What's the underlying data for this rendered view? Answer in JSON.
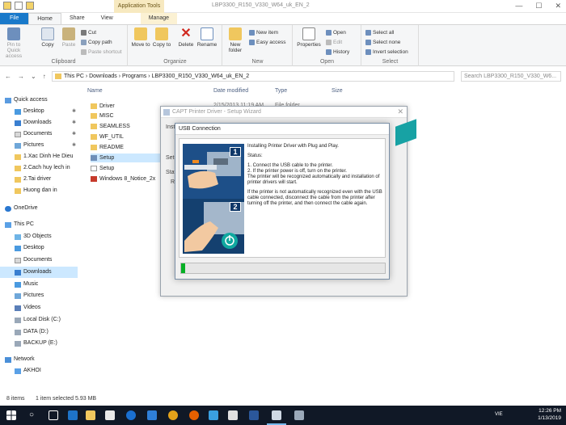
{
  "window": {
    "title": "LBP3300_R150_V330_W64_uk_EN_2",
    "context_tab_group": "Application Tools",
    "controls": [
      "—",
      "☐",
      "✕"
    ]
  },
  "ribbon_tabs": [
    "File",
    "Home",
    "Share",
    "View",
    "Manage"
  ],
  "ribbon": {
    "clipboard": {
      "label": "Clipboard",
      "pin": "Pin to Quick access",
      "copy": "Copy",
      "paste": "Paste",
      "cut": "Cut",
      "copy_path": "Copy path",
      "paste_shortcut": "Paste shortcut"
    },
    "organize": {
      "label": "Organize",
      "move_to": "Move to",
      "copy_to": "Copy to",
      "delete": "Delete",
      "rename": "Rename"
    },
    "new": {
      "label": "New",
      "new_folder": "New folder",
      "new_item": "New item",
      "easy_access": "Easy access"
    },
    "open": {
      "label": "Open",
      "properties": "Properties",
      "open": "Open",
      "edit": "Edit",
      "history": "History"
    },
    "select": {
      "label": "Select",
      "select_all": "Select all",
      "select_none": "Select none",
      "invert": "Invert selection"
    }
  },
  "address": {
    "crumbs": "This PC  ›  Downloads  ›  Programs  ›  LBP3300_R150_V330_W64_uk_EN_2",
    "search_placeholder": "Search LBP3300_R150_V330_W6..."
  },
  "nav": {
    "quick_access": "Quick access",
    "items": [
      "Desktop",
      "Downloads",
      "Documents",
      "Pictures",
      "1.Xac Dinh He Dieu",
      "2.Cach huy lech in",
      "2.Tai driver",
      "Huong dan in"
    ],
    "onedrive": "OneDrive",
    "this_pc": "This PC",
    "pc_items": [
      "3D Objects",
      "Desktop",
      "Documents",
      "Downloads",
      "Music",
      "Pictures",
      "Videos",
      "Local Disk (C:)",
      "DATA (D:)",
      "BACKUP (E:)"
    ],
    "network": "Network",
    "network_items": [
      "AKHOI"
    ]
  },
  "list": {
    "columns": [
      "Name",
      "Date modified",
      "Type",
      "Size"
    ],
    "first_row_date": "2/15/2013 11:19 AM",
    "first_row_type": "File folder",
    "files": [
      {
        "name": "Driver",
        "kind": "folder"
      },
      {
        "name": "MISC",
        "kind": "folder"
      },
      {
        "name": "SEAMLESS",
        "kind": "folder"
      },
      {
        "name": "WF_UTIL",
        "kind": "folder"
      },
      {
        "name": "README",
        "kind": "folder"
      },
      {
        "name": "Setup",
        "kind": "app"
      },
      {
        "name": "Setup",
        "kind": "txt"
      },
      {
        "name": "Windows 8_Notice_2x",
        "kind": "pdf"
      }
    ]
  },
  "wizard": {
    "title": "CAPT Printer Driver - Setup Wizard",
    "left_labels": [
      "Install",
      "Setup",
      "Stat",
      "Re"
    ]
  },
  "usb_dialog": {
    "title": "USB Connection",
    "steps": [
      "1",
      "2"
    ],
    "intro": "Installing Printer Driver with Plug and Play.",
    "status_label": "Status:",
    "step1": "1. Connect the USB cable to the printer.",
    "step2": "2. If the printer power is off, turn on the printer.",
    "step3": "The printer will be recognized automatically and installation of printer drivers will start.",
    "note": "If the printer is not automatically recognized even with the USB cable connected, disconnect the cable from the printer after turning off the printer, and then connect the cable again.",
    "progress": 0.02
  },
  "status_bar": {
    "items": "8 items",
    "selected": "1 item selected  5.93 MB"
  },
  "taskbar": {
    "lang": "VIE",
    "time": "12:26 PM",
    "date": "1/13/2019"
  },
  "colors": {
    "accent": "#1979ca",
    "selection": "#cce8ff",
    "progress": "#06b025",
    "taskbar": "#101826"
  }
}
